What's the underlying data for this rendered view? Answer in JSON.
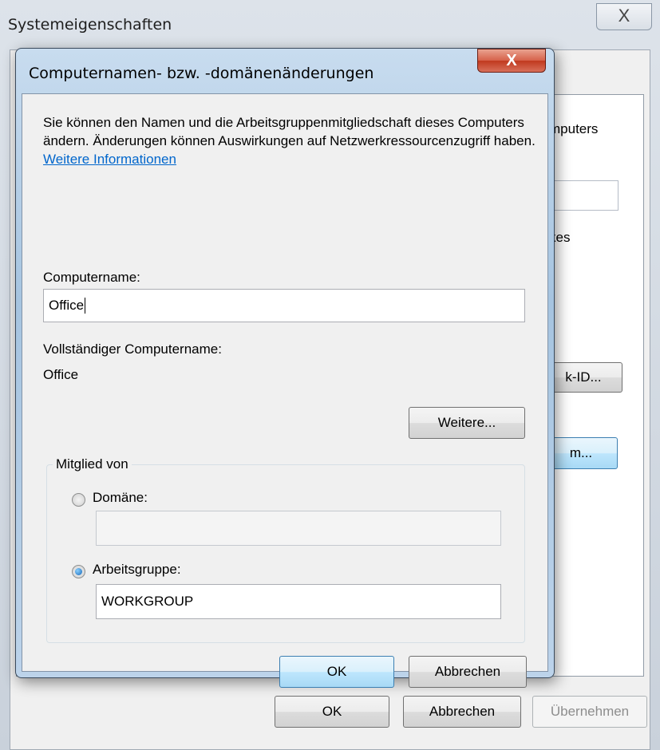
{
  "background_window": {
    "title": "Systemeigenschaften",
    "close_glyph": "X",
    "partial_text": [
      "mputers",
      "kes"
    ],
    "network_id_button": "k-ID...",
    "change_button": "m...",
    "ok_label": "OK",
    "cancel_label": "Abbrechen",
    "apply_label": "Übernehmen"
  },
  "dialog": {
    "title": "Computernamen- bzw. -domänenänderungen",
    "close_glyph": "X",
    "intro_text": "Sie können den Namen und die Arbeitsgruppenmitgliedschaft dieses Computers ändern. Änderungen können Auswirkungen auf Netzwerkressourcenzugriff haben.",
    "more_info_link": "Weitere Informationen",
    "computer_name_label": "Computername:",
    "computer_name_value": "Office",
    "full_name_label": "Vollständiger Computername:",
    "full_name_value": "Office",
    "more_button": "Weitere...",
    "member_of": {
      "legend": "Mitglied von",
      "domain_label": "Domäne:",
      "domain_value": "",
      "domain_selected": false,
      "workgroup_label": "Arbeitsgruppe:",
      "workgroup_value": "WORKGROUP",
      "workgroup_selected": true
    },
    "ok_label": "OK",
    "cancel_label": "Abbrechen"
  },
  "colors": {
    "link": "#0066cc",
    "title_bar": "#a6c4e0",
    "close_button": "#c0391e",
    "focus_button_border": "#3c7fb1"
  }
}
